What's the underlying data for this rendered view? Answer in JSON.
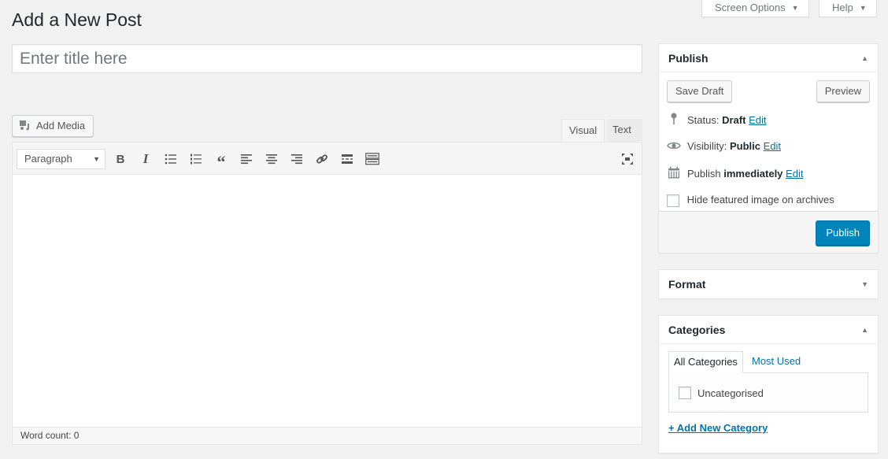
{
  "screen_meta": {
    "screen_options_label": "Screen Options",
    "help_label": "Help"
  },
  "page_title": "Add a New Post",
  "title_input": {
    "placeholder": "Enter title here",
    "value": ""
  },
  "editor": {
    "add_media_label": "Add Media",
    "tabs": [
      {
        "label": "Visual",
        "active": true
      },
      {
        "label": "Text",
        "active": false
      }
    ],
    "format_select": {
      "selected": "Paragraph"
    },
    "toolbar_buttons": [
      "bold",
      "italic",
      "bulleted-list",
      "numbered-list",
      "blockquote",
      "align-left",
      "align-center",
      "align-right",
      "insert-link",
      "read-more",
      "toolbar-toggle"
    ],
    "fullscreen_icon": "distraction-free-icon",
    "word_count_label": "Word count: 0"
  },
  "publish": {
    "title": "Publish",
    "save_draft_label": "Save Draft",
    "preview_label": "Preview",
    "status": {
      "label": "Status:",
      "value": "Draft",
      "edit": "Edit"
    },
    "visibility": {
      "label": "Visibility:",
      "value": "Public",
      "edit": "Edit"
    },
    "schedule": {
      "label": "Publish",
      "value": "immediately",
      "edit": "Edit"
    },
    "hide_featured_label": "Hide featured image on archives",
    "hide_featured_checked": false,
    "publish_label": "Publish",
    "accent_color": "#0085ba"
  },
  "format": {
    "title": "Format"
  },
  "categories": {
    "title": "Categories",
    "tabs": [
      {
        "label": "All Categories",
        "active": true
      },
      {
        "label": "Most Used",
        "active": false
      }
    ],
    "items": [
      {
        "label": "Uncategorised",
        "checked": false
      }
    ],
    "add_new_label": "+ Add New Category"
  }
}
